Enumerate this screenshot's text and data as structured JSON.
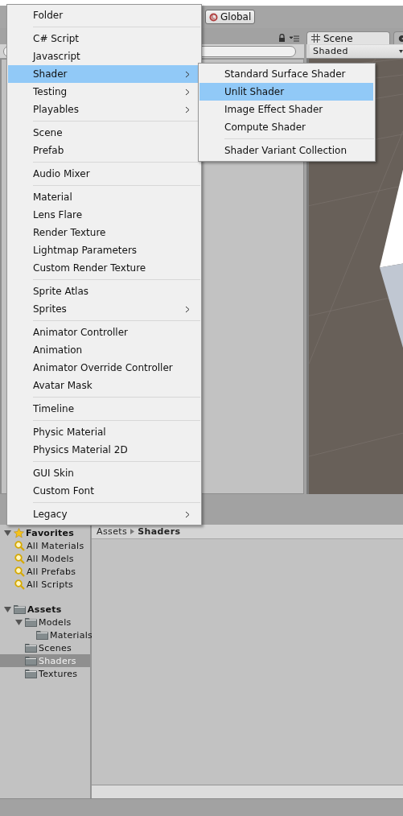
{
  "toolbar": {
    "pivot_button": "Global"
  },
  "scene_panel": {
    "tabs": [
      {
        "label": "Scene",
        "selected": true
      },
      {
        "selected": false
      }
    ],
    "shading_mode": "Shaded"
  },
  "project_panel": {
    "favorites": {
      "label": "Favorites",
      "expanded": true,
      "items": [
        {
          "label": "All Materials",
          "selected": false
        },
        {
          "label": "All Models",
          "selected": false
        },
        {
          "label": "All Prefabs",
          "selected": false
        },
        {
          "label": "All Scripts",
          "selected": false
        }
      ]
    },
    "assets": {
      "label": "Assets",
      "expanded": true,
      "selected": false,
      "children": [
        {
          "label": "Models",
          "expanded": true,
          "selected": false,
          "children": [
            {
              "label": "Materials",
              "expanded": false,
              "selected": false
            }
          ]
        },
        {
          "label": "Scenes",
          "expanded": false,
          "selected": false
        },
        {
          "label": "Shaders",
          "expanded": false,
          "selected": true
        },
        {
          "label": "Textures",
          "expanded": false,
          "selected": false
        }
      ]
    },
    "breadcrumb": [
      {
        "label": "Assets"
      },
      {
        "label": "Shaders"
      }
    ]
  },
  "create_menu": {
    "items": [
      {
        "kind": "item",
        "label": "Folder",
        "selected": false,
        "submenu": false
      },
      {
        "kind": "separator"
      },
      {
        "kind": "item",
        "label": "C# Script",
        "selected": false,
        "submenu": false
      },
      {
        "kind": "item",
        "label": "Javascript",
        "selected": false,
        "submenu": false
      },
      {
        "kind": "item",
        "label": "Shader",
        "selected": true,
        "submenu": true
      },
      {
        "kind": "item",
        "label": "Testing",
        "selected": false,
        "submenu": true
      },
      {
        "kind": "item",
        "label": "Playables",
        "selected": false,
        "submenu": true
      },
      {
        "kind": "separator"
      },
      {
        "kind": "item",
        "label": "Scene",
        "selected": false,
        "submenu": false
      },
      {
        "kind": "item",
        "label": "Prefab",
        "selected": false,
        "submenu": false
      },
      {
        "kind": "separator"
      },
      {
        "kind": "item",
        "label": "Audio Mixer",
        "selected": false,
        "submenu": false
      },
      {
        "kind": "separator"
      },
      {
        "kind": "item",
        "label": "Material",
        "selected": false,
        "submenu": false
      },
      {
        "kind": "item",
        "label": "Lens Flare",
        "selected": false,
        "submenu": false
      },
      {
        "kind": "item",
        "label": "Render Texture",
        "selected": false,
        "submenu": false
      },
      {
        "kind": "item",
        "label": "Lightmap Parameters",
        "selected": false,
        "submenu": false
      },
      {
        "kind": "item",
        "label": "Custom Render Texture",
        "selected": false,
        "submenu": false
      },
      {
        "kind": "separator"
      },
      {
        "kind": "item",
        "label": "Sprite Atlas",
        "selected": false,
        "submenu": false
      },
      {
        "kind": "item",
        "label": "Sprites",
        "selected": false,
        "submenu": true
      },
      {
        "kind": "separator"
      },
      {
        "kind": "item",
        "label": "Animator Controller",
        "selected": false,
        "submenu": false
      },
      {
        "kind": "item",
        "label": "Animation",
        "selected": false,
        "submenu": false
      },
      {
        "kind": "item",
        "label": "Animator Override Controller",
        "selected": false,
        "submenu": false
      },
      {
        "kind": "item",
        "label": "Avatar Mask",
        "selected": false,
        "submenu": false
      },
      {
        "kind": "separator"
      },
      {
        "kind": "item",
        "label": "Timeline",
        "selected": false,
        "submenu": false
      },
      {
        "kind": "separator"
      },
      {
        "kind": "item",
        "label": "Physic Material",
        "selected": false,
        "submenu": false
      },
      {
        "kind": "item",
        "label": "Physics Material 2D",
        "selected": false,
        "submenu": false
      },
      {
        "kind": "separator"
      },
      {
        "kind": "item",
        "label": "GUI Skin",
        "selected": false,
        "submenu": false
      },
      {
        "kind": "item",
        "label": "Custom Font",
        "selected": false,
        "submenu": false
      },
      {
        "kind": "separator"
      },
      {
        "kind": "item",
        "label": "Legacy",
        "selected": false,
        "submenu": true
      }
    ]
  },
  "shader_submenu": {
    "items": [
      {
        "kind": "item",
        "label": "Standard Surface Shader",
        "selected": false,
        "submenu": false
      },
      {
        "kind": "item",
        "label": "Unlit Shader",
        "selected": true,
        "submenu": false
      },
      {
        "kind": "item",
        "label": "Image Effect Shader",
        "selected": false,
        "submenu": false
      },
      {
        "kind": "item",
        "label": "Compute Shader",
        "selected": false,
        "submenu": false
      },
      {
        "kind": "separator"
      },
      {
        "kind": "item",
        "label": "Shader Variant Collection",
        "selected": false,
        "submenu": false
      }
    ]
  }
}
